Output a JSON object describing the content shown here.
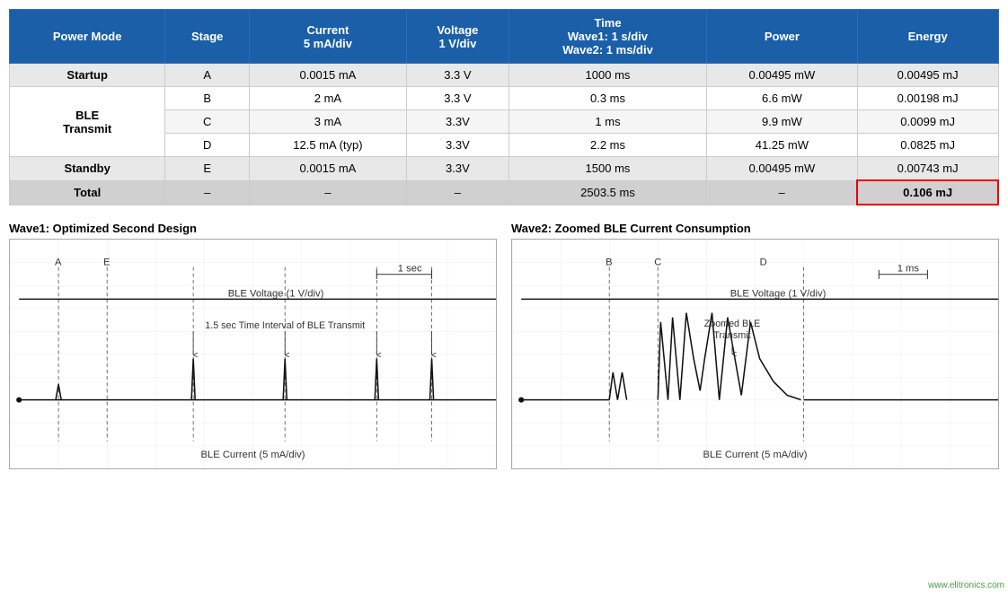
{
  "table": {
    "headers": [
      "Power Mode",
      "Stage",
      "Current\n5 mA/div",
      "Voltage\n1 V/div",
      "Time\nWave1: 1 s/div\nWave2: 1 ms/div",
      "Power",
      "Energy"
    ],
    "rows": [
      {
        "type": "row-startup",
        "cells": [
          "Startup",
          "A",
          "0.0015 mA",
          "3.3 V",
          "1000 ms",
          "0.00495 mW",
          "0.00495 mJ"
        ],
        "boldFirst": true
      },
      {
        "type": "row-white",
        "cells": [
          "BLE\nTransmit",
          "B",
          "2 mA",
          "3.3 V",
          "0.3 ms",
          "6.6 mW",
          "0.00198 mJ"
        ],
        "boldFirst": true,
        "spanFirst": true
      },
      {
        "type": "row-light",
        "cells": [
          "",
          "C",
          "3 mA",
          "3.3V",
          "1 ms",
          "9.9 mW",
          "0.0099 mJ"
        ],
        "boldFirst": false
      },
      {
        "type": "row-white",
        "cells": [
          "",
          "D",
          "12.5 mA (typ)",
          "3.3V",
          "2.2 ms",
          "41.25 mW",
          "0.0825 mJ"
        ],
        "boldFirst": false
      },
      {
        "type": "row-standby",
        "cells": [
          "Standby",
          "E",
          "0.0015 mA",
          "3.3V",
          "1500 ms",
          "0.00495 mW",
          "0.00743 mJ"
        ],
        "boldFirst": true
      },
      {
        "type": "row-total",
        "cells": [
          "Total",
          "–",
          "–",
          "–",
          "2503.5 ms",
          "–",
          "0.106 mJ"
        ],
        "boldFirst": true,
        "highlightLast": true
      }
    ]
  },
  "wave1": {
    "title": "Wave1: Optimized Second Design",
    "label_voltage": "BLE Voltage (1 V/div)",
    "label_current": "BLE Current (5 mA/div)",
    "label_time": "1 sec",
    "label_interval": "1.5 sec Time Interval of BLE Transmit",
    "markers": [
      "A",
      "E"
    ]
  },
  "wave2": {
    "title": "Wave2: Zoomed BLE Current Consumption",
    "label_voltage": "BLE Voltage (1 V/div)",
    "label_current": "BLE Current (5 mA/div)",
    "label_time": "1 ms",
    "label_zoomed": "Zoomed BLE\nTransmit",
    "markers": [
      "B",
      "C",
      "D"
    ]
  },
  "watermark": "www.elitronics.com"
}
